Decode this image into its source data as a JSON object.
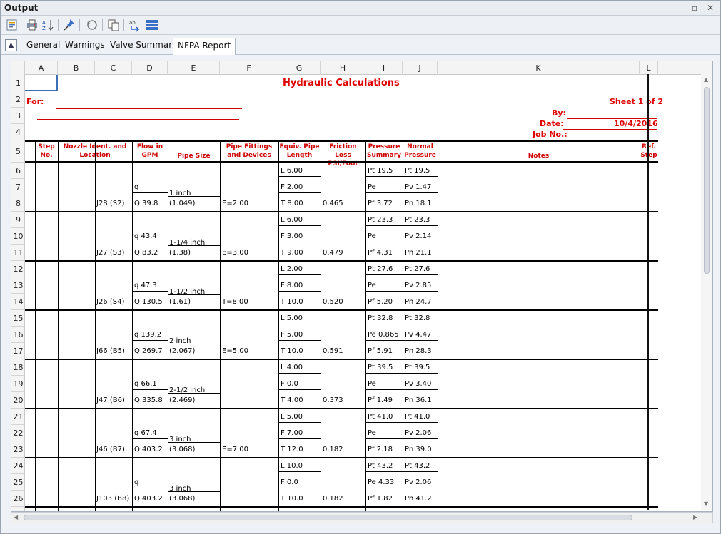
{
  "window": {
    "title": "Output",
    "restore_icon": "restore-icon",
    "close_icon": "close-icon"
  },
  "toolbar": {
    "icons": [
      "report-icon",
      "print-icon",
      "sort-az-icon",
      "pin-icon",
      "refresh-icon",
      "copy-icon",
      "export-icon",
      "columns-icon"
    ]
  },
  "tabs": {
    "labels": [
      "General",
      "Warnings",
      "Valve Summary",
      "NFPA Report"
    ],
    "active": "NFPA Report"
  },
  "sheet": {
    "columns": [
      "A",
      "B",
      "C",
      "D",
      "E",
      "F",
      "G",
      "H",
      "I",
      "J",
      "K",
      "L"
    ],
    "rows": [
      "1",
      "2",
      "3",
      "4",
      "5",
      "6",
      "7",
      "8",
      "9",
      "10",
      "11",
      "12",
      "13",
      "14",
      "15",
      "16",
      "17",
      "18",
      "19",
      "20",
      "21",
      "22",
      "23",
      "24",
      "25",
      "26"
    ],
    "title": "Hydraulic Calculations",
    "for_label": "For:",
    "sheet_label": "Sheet 1 of 2",
    "by_label": "By:",
    "date_label": "Date:",
    "date_value": "10/4/2016",
    "job_label": "Job No.:",
    "headers": {
      "step": "Step No.",
      "nozzle": "Nozzle Ident. and Location",
      "flow": "Flow in GPM",
      "pipe_size": "Pipe Size",
      "fittings": "Pipe Fittings and Devices",
      "equiv": "Equiv. Pipe Length",
      "friction": "Friction Loss PSI/Foot",
      "pressure": "Pressure Summary",
      "normal": "Normal Pressure",
      "notes": "Notes",
      "ref": "Ref. Step"
    },
    "groups": [
      {
        "nozzle": "J28  (S2)",
        "q": "q",
        "Q": "Q  39.8",
        "size1": "1 inch",
        "size2": "(1.049)",
        "fit": "E=2.00",
        "L": "L  6.00",
        "F": "F  2.00",
        "T": "T  8.00",
        "fl": "0.465",
        "pt": "Pt  19.5",
        "pe": "Pe",
        "pf": "Pf  3.72",
        "npt": "Pt  19.5",
        "pv": "Pv  1.47",
        "pn": "Pn  18.1"
      },
      {
        "nozzle": "J27  (S3)",
        "q": "q  43.4",
        "Q": "Q  83.2",
        "size1": "1-1/4 inch",
        "size2": "(1.38)",
        "fit": "E=3.00",
        "L": "L  6.00",
        "F": "F  3.00",
        "T": "T  9.00",
        "fl": "0.479",
        "pt": "Pt  23.3",
        "pe": "Pe",
        "pf": "Pf  4.31",
        "npt": "Pt  23.3",
        "pv": "Pv  2.14",
        "pn": "Pn  21.1"
      },
      {
        "nozzle": "J26  (S4)",
        "q": "q  47.3",
        "Q": "Q  130.5",
        "size1": "1-1/2 inch",
        "size2": "(1.61)",
        "fit": "T=8.00",
        "L": "L  2.00",
        "F": "F  8.00",
        "T": "T  10.0",
        "fl": "0.520",
        "pt": "Pt  27.6",
        "pe": "Pe",
        "pf": "Pf  5.20",
        "npt": "Pt  27.6",
        "pv": "Pv  2.85",
        "pn": "Pn  24.7"
      },
      {
        "nozzle": "J66  (B5)",
        "q": "q  139.2",
        "Q": "Q  269.7",
        "size1": "2 inch",
        "size2": "(2.067)",
        "fit": "E=5.00",
        "L": "L  5.00",
        "F": "F  5.00",
        "T": "T  10.0",
        "fl": "0.591",
        "pt": "Pt  32.8",
        "pe": "Pe  0.865",
        "pf": "Pf  5.91",
        "npt": "Pt  32.8",
        "pv": "Pv  4.47",
        "pn": "Pn  28.3"
      },
      {
        "nozzle": "J47  (B6)",
        "q": "q  66.1",
        "Q": "Q  335.8",
        "size1": "2-1/2 inch",
        "size2": "(2.469)",
        "fit": "",
        "L": "L  4.00",
        "F": "F  0.0",
        "T": "T  4.00",
        "fl": "0.373",
        "pt": "Pt  39.5",
        "pe": "Pe",
        "pf": "Pf  1.49",
        "npt": "Pt  39.5",
        "pv": "Pv  3.40",
        "pn": "Pn  36.1"
      },
      {
        "nozzle": "J46  (B7)",
        "q": "q  67.4",
        "Q": "Q  403.2",
        "size1": "3 inch",
        "size2": "(3.068)",
        "fit": "E=7.00",
        "L": "L  5.00",
        "F": "F  7.00",
        "T": "T  12.0",
        "fl": "0.182",
        "pt": "Pt  41.0",
        "pe": "Pe",
        "pf": "Pf  2.18",
        "npt": "Pt  41.0",
        "pv": "Pv  2.06",
        "pn": "Pn  39.0"
      },
      {
        "nozzle": "J103  (B8)",
        "q": "q",
        "Q": "Q  403.2",
        "size1": "3 inch",
        "size2": "(3.068)",
        "fit": "",
        "L": "L  10.0",
        "F": "F  0.0",
        "T": "T  10.0",
        "fl": "0.182",
        "pt": "Pt  43.2",
        "pe": "Pe  4.33",
        "pf": "Pf  1.82",
        "npt": "Pt  43.2",
        "pv": "Pv  2.06",
        "pn": "Pn  41.2"
      }
    ]
  }
}
